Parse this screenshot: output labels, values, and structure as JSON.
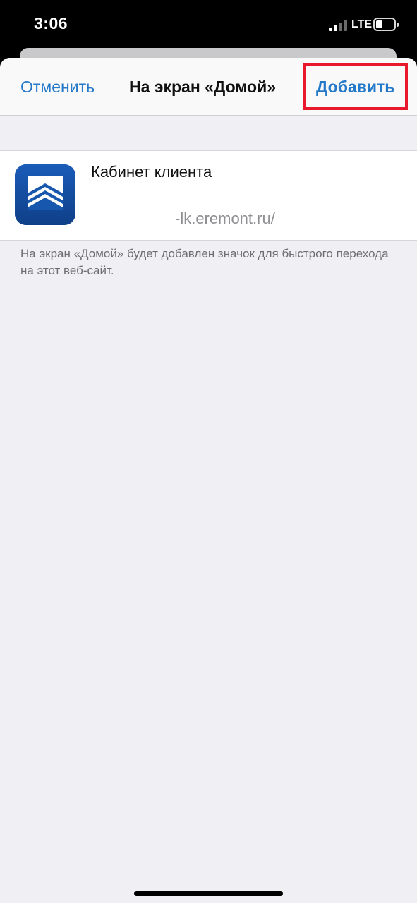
{
  "status_bar": {
    "time": "3:06",
    "network": "LTE",
    "signal_icon": "cellular-signal-icon",
    "battery_icon": "battery-icon"
  },
  "nav": {
    "cancel_label": "Отменить",
    "title": "На экран «Домой»",
    "add_label": "Добавить"
  },
  "bookmark": {
    "icon": "house-roof-app-icon",
    "name": "Кабинет клиента",
    "url": "-lk.eremont.ru/"
  },
  "hint": "На экран «Домой» будет добавлен значок для быстрого перехода на этот веб-сайт.",
  "colors": {
    "accent": "#2479c9",
    "highlight": "#e8192c",
    "icon_background": "#134a9c"
  }
}
